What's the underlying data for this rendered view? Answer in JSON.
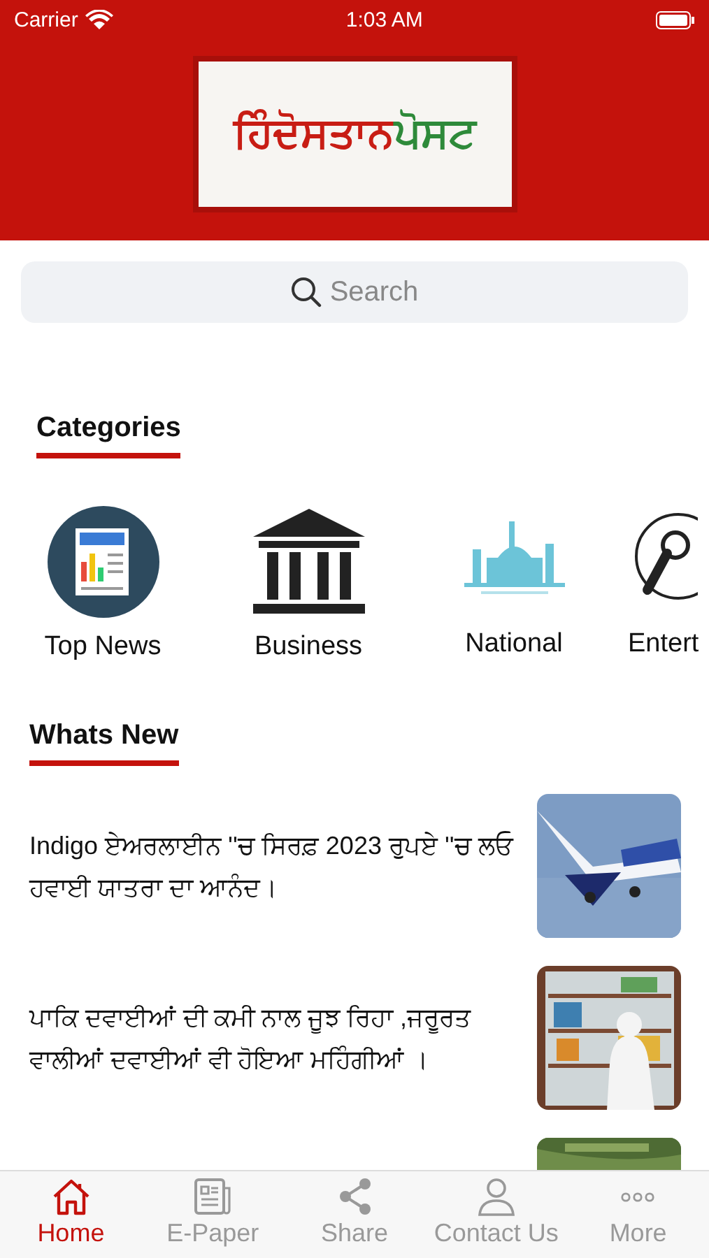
{
  "status_bar": {
    "carrier": "Carrier",
    "time": "1:03 AM"
  },
  "logo": {
    "part_1": "ਹਿੰਦੋਸਤਾਨ",
    "part_2": "ਪੋਸਟ"
  },
  "search": {
    "placeholder": "Search"
  },
  "categories": {
    "title": "Categories",
    "items": [
      {
        "kind": "news",
        "label": "Top News"
      },
      {
        "kind": "bank",
        "label": "Business"
      },
      {
        "kind": "city",
        "label": "National"
      },
      {
        "kind": "mic",
        "label": "Entert"
      }
    ]
  },
  "whats_new": {
    "title": "Whats New",
    "items": [
      {
        "headline": "Indigo ਏਅਰਲਾਈਨ ''ਚ ਸਿਰਫ਼ 2023 ਰੁਪਏ ''ਚ ਲਓ ਹਵਾਈ ਯਾਤਰਾ ਦਾ ਆਨੰਦ।",
        "thumbnail": {
          "kind": "picture"
        }
      },
      {
        "headline": "ਪਾਕਿ ਦਵਾਈਆਂ ਦੀ ਕਮੀ ਨਾਲ ਜੂਝ ਰਿਹਾ ,ਜਰੂਰਤ ਵਾਲੀਆਂ ਦਵਾਈਆਂ ਵੀ ਹੋਇਆ ਮਹਿੰਗੀਆਂ ।",
        "thumbnail": {
          "kind": "picture"
        }
      },
      {
        "thumbnail": {
          "kind": "picture"
        }
      }
    ]
  },
  "tab_bar": [
    {
      "kind": "home",
      "label": "Home",
      "selected": true
    },
    {
      "kind": "paper",
      "label": "E-Paper",
      "selected": false
    },
    {
      "kind": "share",
      "label": "Share",
      "selected": false
    },
    {
      "kind": "person",
      "label": "Contact Us",
      "selected": false
    },
    {
      "kind": "more",
      "label": "More",
      "selected": false
    }
  ]
}
